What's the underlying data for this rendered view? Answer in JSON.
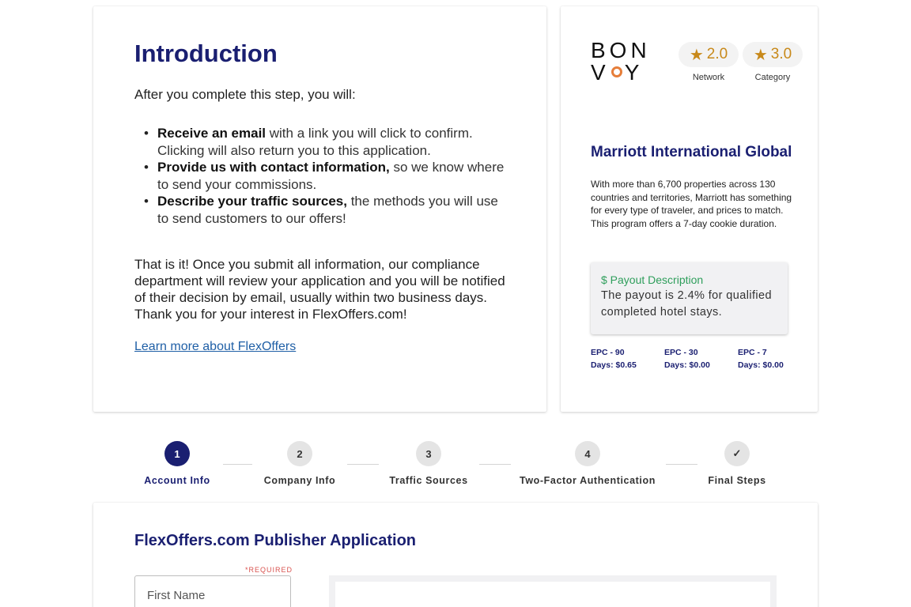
{
  "intro": {
    "title": "Introduction",
    "lead": "After you complete this step, you will:",
    "bullets": [
      {
        "bold": "Receive an email",
        "rest": " with a link you will click to confirm. Clicking will also return you to this application."
      },
      {
        "bold": "Provide us with contact information,",
        "rest": " so we know where to send your commissions."
      },
      {
        "bold": "Describe your traffic sources,",
        "rest": " the methods you will use to send customers to our offers!"
      }
    ],
    "paragraph": "That is it! Once you submit all information, our compliance department will review your application and you will be notified of their decision by email, usually within two business days. Thank you for your interest in FlexOffers.com!",
    "learn_more": "Learn more about FlexOffers"
  },
  "offer": {
    "logo_line1": "BON",
    "logo_line2a": "V",
    "logo_line2b": "Y",
    "ratings": [
      {
        "value": "2.0",
        "caption": "Network"
      },
      {
        "value": "3.0",
        "caption": "Category"
      }
    ],
    "name": "Marriott International Global",
    "description": "With more than 6,700 properties across 130 countries and territories, Marriott has something for every type of traveler, and prices to match. This program offers a 7-day cookie duration.",
    "payout_title": "$ Payout Description",
    "payout_text": "The payout is 2.4% for qualified completed hotel stays.",
    "epc": [
      {
        "label": "EPC - 90",
        "value": "Days: $0.65"
      },
      {
        "label": "EPC - 30",
        "value": "Days: $0.00"
      },
      {
        "label": "EPC - 7",
        "value": "Days: $0.00"
      }
    ],
    "colors": {
      "brand_navy": "#1a1f71",
      "star": "#c8891a",
      "payout_green": "#2e9e5b",
      "logo_accent": "#e67e3a"
    }
  },
  "stepper": {
    "steps": [
      {
        "num": "1",
        "label": "Account Info",
        "state": "active"
      },
      {
        "num": "2",
        "label": "Company Info",
        "state": "pending"
      },
      {
        "num": "3",
        "label": "Traffic Sources",
        "state": "pending"
      },
      {
        "num": "4",
        "label": "Two-Factor Authentication",
        "state": "pending"
      },
      {
        "num": "✓",
        "label": "Final Steps",
        "state": "pending"
      }
    ]
  },
  "application": {
    "title": "FlexOffers.com Publisher Application",
    "required_label": "*REQUIRED",
    "first_name_placeholder": "First Name"
  }
}
